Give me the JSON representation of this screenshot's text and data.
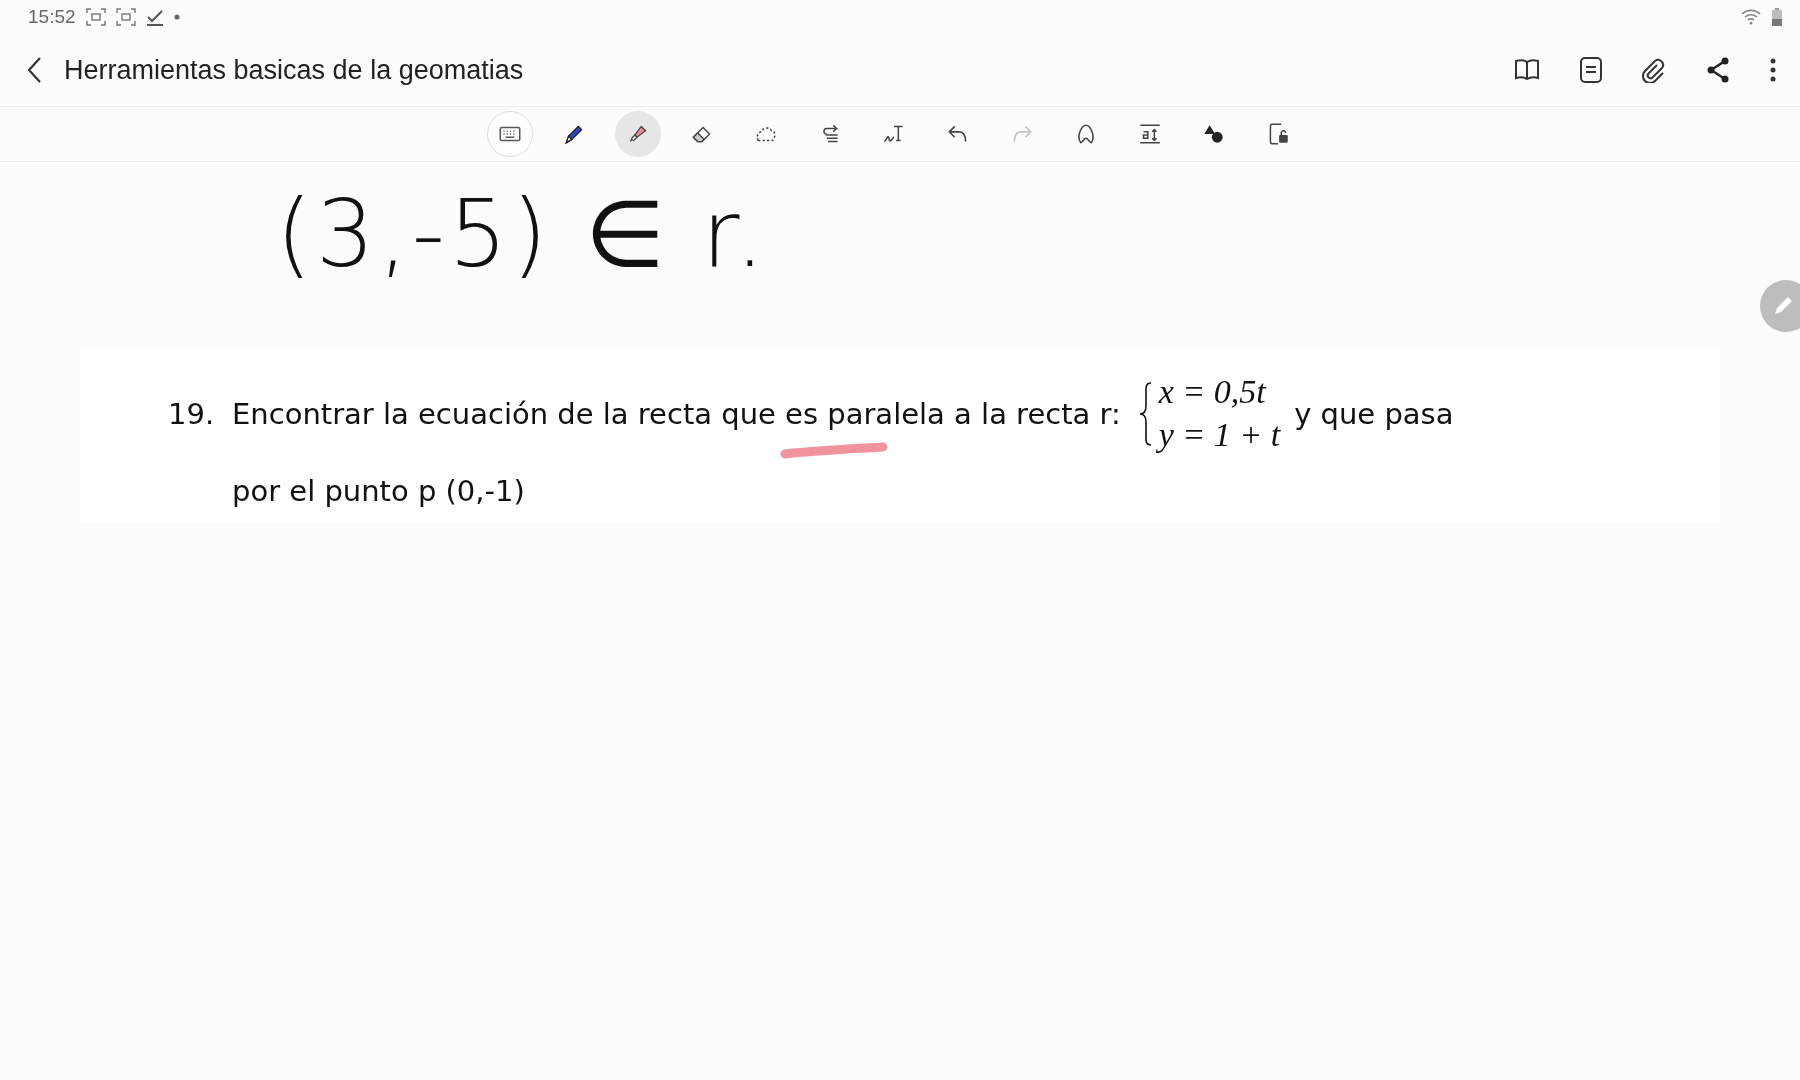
{
  "status_bar": {
    "time": "15:52"
  },
  "header": {
    "title": "Herramientas basicas de la geomatias"
  },
  "toolbar": [
    {
      "kind": "keyboard",
      "selected": false,
      "disabled": false
    },
    {
      "kind": "pen",
      "selected": false,
      "disabled": false
    },
    {
      "kind": "highlighter",
      "selected": true,
      "disabled": false
    },
    {
      "kind": "eraser",
      "selected": false,
      "disabled": false
    },
    {
      "kind": "lasso",
      "selected": false,
      "disabled": false
    },
    {
      "kind": "format",
      "selected": false,
      "disabled": false
    },
    {
      "kind": "handwriting-text",
      "selected": false,
      "disabled": false
    },
    {
      "kind": "undo",
      "selected": false,
      "disabled": false
    },
    {
      "kind": "redo",
      "selected": false,
      "disabled": true
    },
    {
      "kind": "shape-pen",
      "selected": false,
      "disabled": false
    },
    {
      "kind": "text-size",
      "selected": false,
      "disabled": false
    },
    {
      "kind": "shapes",
      "selected": false,
      "disabled": false
    },
    {
      "kind": "lock",
      "selected": false,
      "disabled": false
    }
  ],
  "handwriting": "(3,-5) ∈ r.",
  "problem": {
    "number": "19.",
    "text_before": "Encontrar la ecuación de la recta que es paralela a la recta r:",
    "system": [
      "x = 0,5t",
      "y = 1 + t"
    ],
    "text_after": "y que pasa",
    "text_continued": "por el punto p (0,-1)"
  }
}
